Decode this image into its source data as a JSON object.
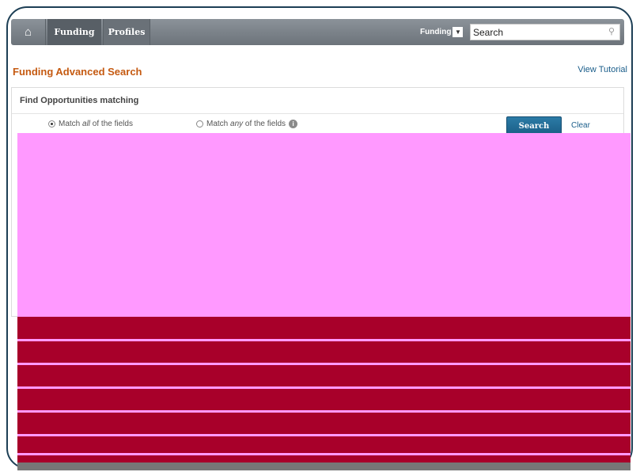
{
  "nav": {
    "home_icon": "home-icon",
    "tabs": [
      {
        "label": "Funding",
        "active": true
      },
      {
        "label": "Profiles",
        "active": false
      }
    ],
    "scope_label": "Funding",
    "search_placeholder": "Search"
  },
  "page": {
    "title": "Funding Advanced Search",
    "tutorial_link": "View Tutorial"
  },
  "panel": {
    "header": "Find Opportunities matching",
    "match_all_label_prefix": "Match ",
    "match_all_emphasis": "all",
    "match_all_label_suffix": " of the fields",
    "match_any_label_prefix": "Match ",
    "match_any_emphasis": "any",
    "match_any_label_suffix": " of the fields",
    "search_button": "Search",
    "clear_link": "Clear"
  },
  "colors": {
    "accent_orange": "#c55a11",
    "link_blue": "#1a5d8a",
    "button_blue": "#1a5d86",
    "redact_magenta": "#ff99ff",
    "redact_crimson": "#a8002a"
  }
}
